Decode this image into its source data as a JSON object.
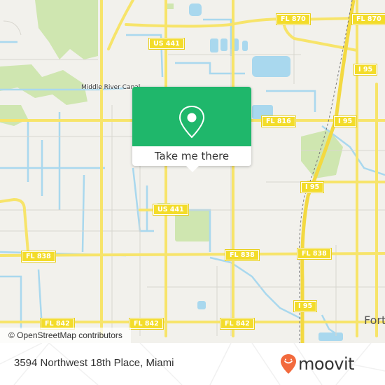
{
  "map": {
    "highway_shields": [
      {
        "label": "FL 870",
        "id": "fl-870-west"
      },
      {
        "label": "FL 870",
        "id": "fl-870-east"
      },
      {
        "label": "US 441",
        "id": "us-441-north"
      },
      {
        "label": "I 95",
        "id": "i95-north"
      },
      {
        "label": "FL 816",
        "id": "fl-816"
      },
      {
        "label": "I 95",
        "id": "i95-fl816"
      },
      {
        "label": "I 95",
        "id": "i95-mid"
      },
      {
        "label": "US 441",
        "id": "us-441-south"
      },
      {
        "label": "FL 838",
        "id": "fl-838-west"
      },
      {
        "label": "FL 838",
        "id": "fl-838-mid"
      },
      {
        "label": "FL 838",
        "id": "fl-838-east"
      },
      {
        "label": "I 95",
        "id": "i95-south"
      },
      {
        "label": "FL 842",
        "id": "fl-842-west"
      },
      {
        "label": "FL 842",
        "id": "fl-842-mid"
      },
      {
        "label": "FL 842",
        "id": "fl-842-east"
      }
    ],
    "place_labels": {
      "canal": "Middle River Canal",
      "city_partial": "Fort"
    },
    "attribution": "© OpenStreetMap contributors",
    "colors": {
      "land": "#f2f1ec",
      "water": "#a9d8ee",
      "park": "#cfe6b0",
      "road_major": "#f7e46a",
      "road_minor": "#d8d6cf"
    }
  },
  "popup": {
    "icon": "map-pin-icon",
    "button_label": "Take me there",
    "accent_color": "#1fb76b"
  },
  "footer": {
    "address": "3594 Northwest 18th Place, Miami",
    "brand": "moovit",
    "brand_color": "#f26a3d"
  }
}
